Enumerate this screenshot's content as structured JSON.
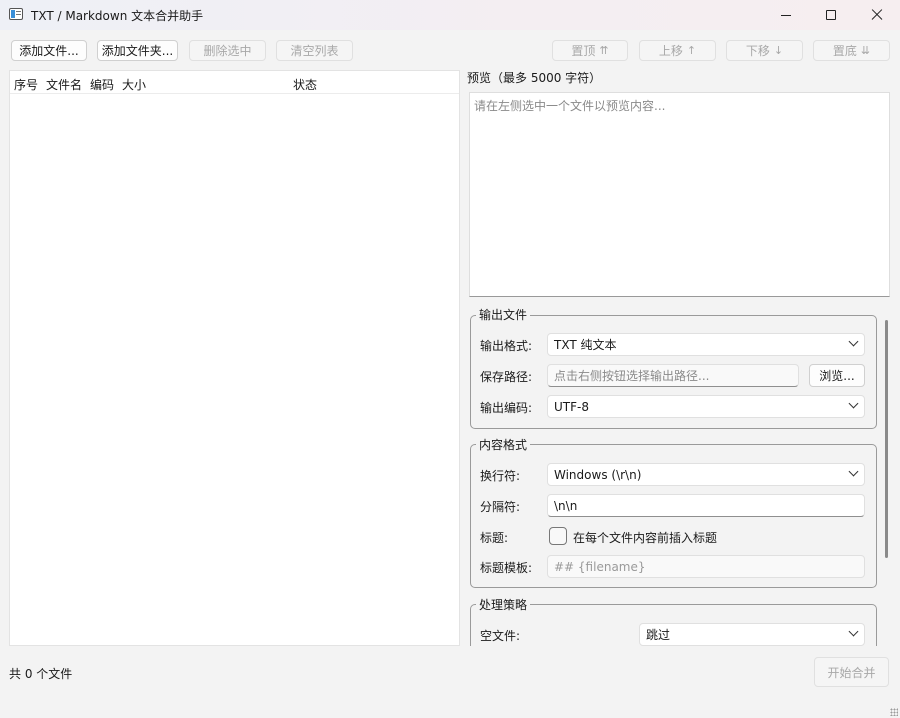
{
  "window": {
    "title": "TXT / Markdown 文本合并助手"
  },
  "toolbar": {
    "add_files": "添加文件...",
    "add_folder": "添加文件夹...",
    "remove_selected": "删除选中",
    "clear_list": "清空列表",
    "move_top": "置顶",
    "move_up": "上移",
    "move_down": "下移",
    "move_bottom": "置底",
    "arrows": {
      "top": "⇈",
      "up": "↑",
      "down": "↓",
      "bottom": "⇊"
    }
  },
  "file_table": {
    "columns": [
      "序号",
      "文件名",
      "编码",
      "大小",
      "状态"
    ],
    "rows": []
  },
  "preview": {
    "label": "预览（最多 5000 字符）",
    "placeholder": "请在左侧选中一个文件以预览内容..."
  },
  "output_group": {
    "title": "输出文件",
    "format_label": "输出格式:",
    "format_value": "TXT 纯文本",
    "path_label": "保存路径:",
    "path_placeholder": "点击右侧按钮选择输出路径...",
    "browse_button": "浏览...",
    "encoding_label": "输出编码:",
    "encoding_value": "UTF-8"
  },
  "content_group": {
    "title": "内容格式",
    "newline_label": "换行符:",
    "newline_value": "Windows (\\r\\n)",
    "separator_label": "分隔符:",
    "separator_value": "\\n\\n",
    "heading_label": "标题:",
    "heading_checkbox_label": "在每个文件内容前插入标题",
    "template_label": "标题模板:",
    "template_placeholder": "## {filename}"
  },
  "strategy_group": {
    "title": "处理策略",
    "empty_file_label": "空文件:",
    "empty_file_value": "跳过"
  },
  "footer": {
    "file_count": "共 0 个文件",
    "start_button": "开始合并"
  }
}
